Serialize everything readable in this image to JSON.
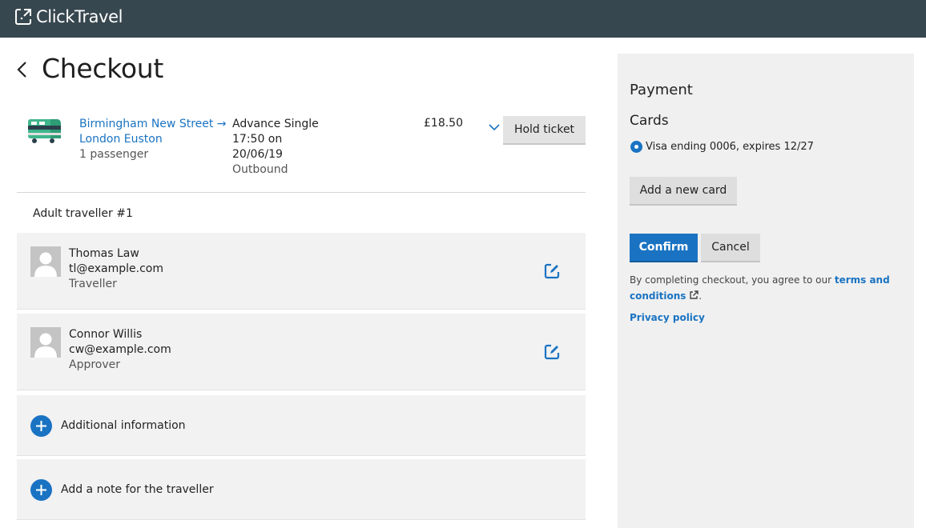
{
  "brand": {
    "name": "ClickTravel"
  },
  "page": {
    "title": "Checkout"
  },
  "journey": {
    "route_line1": "Birmingham New Street →",
    "route_line2": "London Euston",
    "passengers": "1 passenger",
    "fare_type": "Advance Single",
    "time": "17:50 on",
    "date": "20/06/19",
    "direction": "Outbound",
    "price": "£18.50",
    "hold_label": "Hold ticket"
  },
  "traveller_section": {
    "label": "Adult traveller #1"
  },
  "people": [
    {
      "name": "Thomas Law",
      "email": "tl@example.com",
      "role": "Traveller"
    },
    {
      "name": "Connor Willis",
      "email": "cw@example.com",
      "role": "Approver"
    }
  ],
  "extras": {
    "additional_info": "Additional information",
    "add_note": "Add a note for the traveller"
  },
  "payment": {
    "title": "Payment",
    "cards_title": "Cards",
    "selected_card": "Visa ending 0006, expires 12/27",
    "add_card_label": "Add a new card",
    "confirm_label": "Confirm",
    "cancel_label": "Cancel",
    "terms_prefix": "By completing checkout, you agree to our",
    "terms_link": "terms and conditions",
    "terms_suffix": ".",
    "privacy_label": "Privacy policy"
  },
  "colors": {
    "topbar": "#37474f",
    "accent": "#1a73c2",
    "card_bg": "#f2f2f3",
    "panel_bg": "#f0f0f0"
  },
  "icons": [
    "clicktravel-logo-icon",
    "back-arrow-icon",
    "train-icon",
    "chevron-down-icon",
    "avatar-icon",
    "edit-icon",
    "plus-circle-icon",
    "radio-selected-icon",
    "external-link-icon"
  ]
}
